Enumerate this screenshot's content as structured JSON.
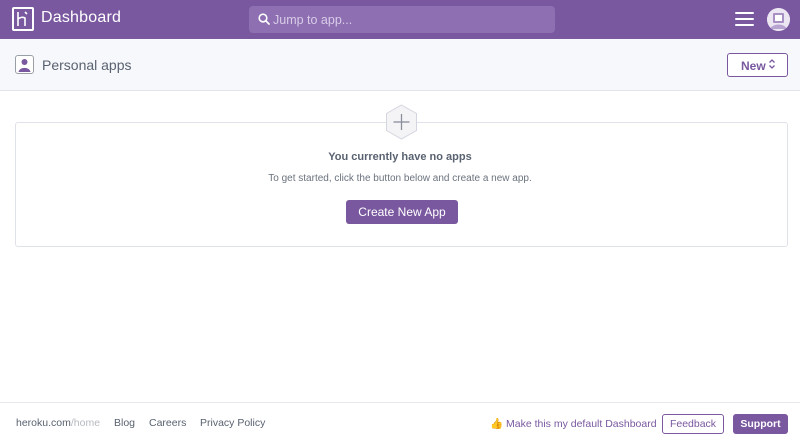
{
  "header": {
    "title": "Dashboard",
    "logo_icon": "heroku-logo-icon",
    "search_placeholder": "Jump to app...",
    "search_icon": "search-icon",
    "menu_icon": "hamburger-menu-icon",
    "avatar_icon": "user-avatar-icon"
  },
  "subheader": {
    "account_label": "Personal apps",
    "account_icon": "person-icon",
    "new_button_label": "New",
    "new_button_icon": "chevron-up-down-icon"
  },
  "empty_state": {
    "icon": "plus-hexagon-icon",
    "title": "You currently have no apps",
    "subtitle": "To get started, click the button below and create a new app.",
    "button_label": "Create New App"
  },
  "footer": {
    "site": "heroku.com",
    "site_path": "/home",
    "links": [
      "Blog",
      "Careers",
      "Privacy Policy"
    ],
    "default_link": "👍 Make this my default Dashboard",
    "feedback_label": "Feedback",
    "support_label": "Support"
  },
  "colors": {
    "brand": "#79589f",
    "search_bg": "#8e6fb1",
    "subbar_bg": "#f7f8fb"
  }
}
